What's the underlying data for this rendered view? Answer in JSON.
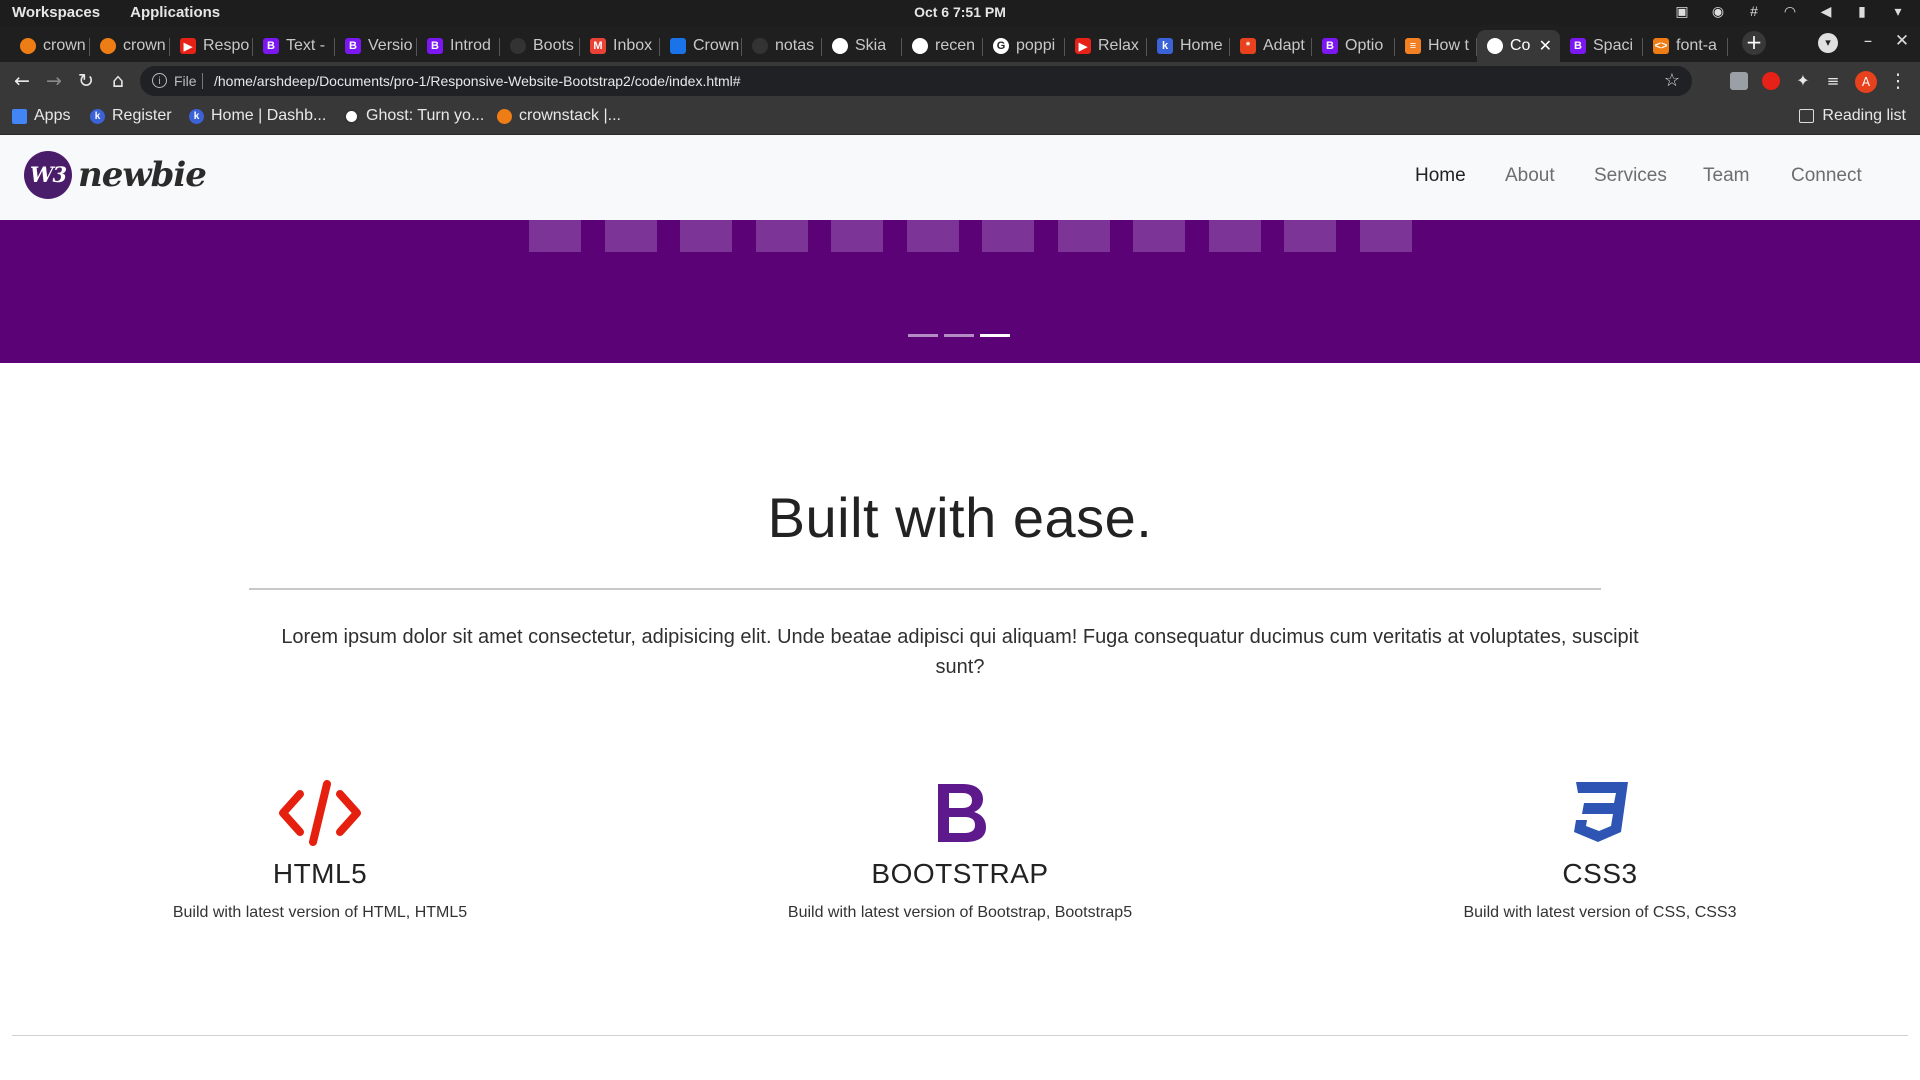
{
  "os": {
    "workspaces": "Workspaces",
    "applications": "Applications",
    "clock": "Oct 6   7:51 PM"
  },
  "browser": {
    "tabs": [
      {
        "title": "crown",
        "icon": "crownstack-icon",
        "color": "#ef7d16"
      },
      {
        "title": "crown",
        "icon": "crownstack-icon",
        "color": "#ef7d16"
      },
      {
        "title": "Respo",
        "icon": "youtube-icon",
        "color": "#e62117"
      },
      {
        "title": "Text -",
        "icon": "bootstrap-icon",
        "color": "#7b17f1"
      },
      {
        "title": "Versio",
        "icon": "bootstrap-icon",
        "color": "#7b17f1"
      },
      {
        "title": "Introd",
        "icon": "bootstrap-icon",
        "color": "#7b17f1"
      },
      {
        "title": "Boots",
        "icon": "github-icon",
        "color": "#333333"
      },
      {
        "title": "Inbox",
        "icon": "gmail-icon",
        "color": "#ea4335"
      },
      {
        "title": "Crown",
        "icon": "calendar-icon",
        "color": "#1a73e8"
      },
      {
        "title": "notas",
        "icon": "github-icon",
        "color": "#333333"
      },
      {
        "title": "Skia",
        "icon": "globe-icon",
        "color": "#ffffff"
      },
      {
        "title": "recen",
        "icon": "globe-icon",
        "color": "#ffffff"
      },
      {
        "title": "poppi",
        "icon": "google-icon",
        "color": "#ffffff"
      },
      {
        "title": "Relax",
        "icon": "youtube-icon",
        "color": "#e62117"
      },
      {
        "title": "Home",
        "icon": "k-icon",
        "color": "#3b62d6"
      },
      {
        "title": "Adapt",
        "icon": "asterisk-icon",
        "color": "#e8411e"
      },
      {
        "title": "Optio",
        "icon": "bootstrap-icon",
        "color": "#7b17f1"
      },
      {
        "title": "How t",
        "icon": "stackoverflow-icon",
        "color": "#f48024"
      },
      {
        "title": "Co",
        "icon": "globe-icon",
        "color": "#ffffff",
        "active": true
      },
      {
        "title": "Spaci",
        "icon": "bootstrap-icon",
        "color": "#7b17f1"
      },
      {
        "title": "font-a",
        "icon": "code-icon",
        "color": "#ef7d16"
      }
    ],
    "url_scheme": "File",
    "url": "/home/arshdeep/Documents/pro-1/Responsive-Website-Bootstrap2/code/index.html#",
    "profile_initial": "A",
    "bookmarks": [
      {
        "label": "Apps",
        "icon": "apps-grid-icon"
      },
      {
        "label": "Register",
        "icon": "k-icon"
      },
      {
        "label": "Home | Dashb...",
        "icon": "k-icon"
      },
      {
        "label": "Ghost: Turn yo...",
        "icon": "ghost-icon"
      },
      {
        "label": "crownstack |...",
        "icon": "crownstack-icon"
      }
    ],
    "reading_list": "Reading list"
  },
  "site": {
    "logo_mark": "W3",
    "logo_text": "newbie",
    "nav": [
      "Home",
      "About",
      "Services",
      "Team",
      "Connect"
    ],
    "active_nav": "Home",
    "hero_color": "#5c0277",
    "carousel_active_slide": 3,
    "carousel_slide_count": 3,
    "feature": {
      "title": "Built with ease.",
      "text": "Lorem ipsum dolor sit amet consectetur, adipisicing elit. Unde beatae adipisci qui aliquam! Fuga consequatur ducimus cum veritatis at voluptates, suscipit sunt?"
    },
    "cards": [
      {
        "title": "HTML5",
        "text": "Build with latest version of HTML, HTML5",
        "icon": "code-tag-icon",
        "color": "#e5200f"
      },
      {
        "title": "BOOTSTRAP",
        "text": "Build with latest version of Bootstrap, Bootstrap5",
        "icon": "bootstrap-icon",
        "color": "#5e1a8c"
      },
      {
        "title": "CSS3",
        "text": "Build with latest version of CSS, CSS3",
        "icon": "css3-icon",
        "color": "#2e55b3"
      }
    ]
  }
}
